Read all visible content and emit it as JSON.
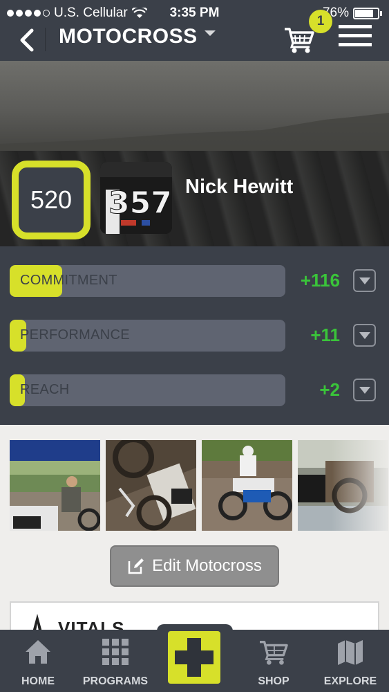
{
  "status_bar": {
    "carrier": "U.S. Cellular",
    "time": "3:35 PM",
    "battery": "76%"
  },
  "nav": {
    "title": "MOTOCROSS",
    "cart_count": "1"
  },
  "profile": {
    "score": "520",
    "name": "Nick Hewitt",
    "avatar_jersey_number": "357"
  },
  "metrics": [
    {
      "label": "COMMITMENT",
      "delta": "+116",
      "level": 0.19
    },
    {
      "label": "PERFORMANCE",
      "delta": "+11",
      "level": 0.06
    },
    {
      "label": "REACH",
      "delta": "+2",
      "level": 0.05
    }
  ],
  "gallery": {
    "photos": [
      "photo-1",
      "photo-2",
      "photo-3",
      "photo-4"
    ]
  },
  "edit_button": {
    "label": "Edit Motocross"
  },
  "card": {
    "text": "VITALS"
  },
  "tabs": [
    {
      "label": "HOME",
      "icon": "home-icon"
    },
    {
      "label": "PROGRAMS",
      "icon": "grid-icon"
    },
    {
      "label": "SHOP",
      "icon": "cart-icon"
    },
    {
      "label": "EXPLORE",
      "icon": "map-icon"
    }
  ],
  "colors": {
    "accent": "#d7e02a",
    "panel": "#3b4049",
    "positive": "#3ac43a"
  }
}
